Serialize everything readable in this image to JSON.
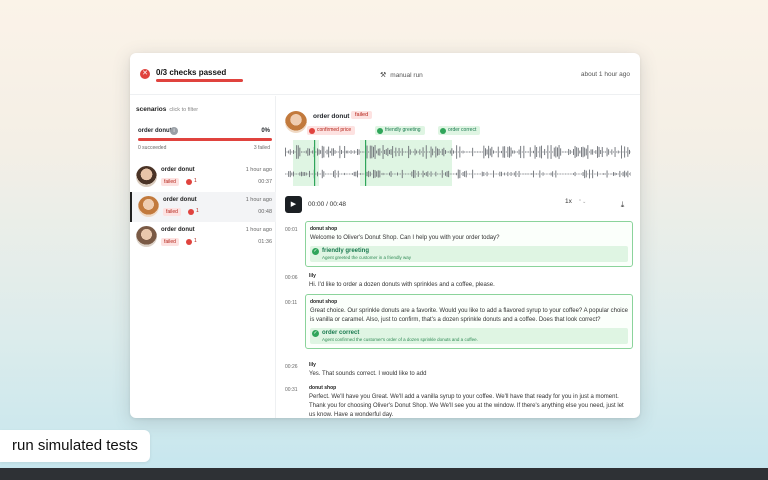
{
  "header": {
    "checks_title": "0/3 checks passed",
    "run_label": "manual run",
    "time_ago": "about 1 hour ago"
  },
  "sidebar": {
    "heading": "scenarios",
    "hint": "click to filter",
    "scenario": {
      "name": "order donut",
      "percent": "0%",
      "succeeded": "0 succeeded",
      "failed": "3 failed"
    },
    "runs": [
      {
        "name": "order donut",
        "time": "1 hour ago",
        "status": "failed",
        "fail_count": "1",
        "duration": "00:37"
      },
      {
        "name": "order donut",
        "time": "1 hour ago",
        "status": "failed",
        "fail_count": "1",
        "duration": "00:48"
      },
      {
        "name": "order donut",
        "time": "1 hour ago",
        "status": "failed",
        "fail_count": "1",
        "duration": "01:36"
      }
    ]
  },
  "main": {
    "title": "order donut",
    "status": "failed",
    "tags": [
      {
        "label": "confirmed price",
        "state": "fail"
      },
      {
        "label": "friendly greeting",
        "state": "pass"
      },
      {
        "label": "order correct",
        "state": "pass"
      }
    ],
    "player": {
      "time": "00:00 / 00:48",
      "speed": "1x"
    },
    "transcript": [
      {
        "ts": "00:01",
        "speaker": "donut shop",
        "text": "Welcome to Oliver's Donut Shop. Can I help you with your order today?",
        "check_name": "friendly greeting",
        "check_desc": "Agent greeted the customer in a friendly way"
      },
      {
        "ts": "00:06",
        "speaker": "lily",
        "text": "Hi. I'd like to order a dozen donuts with sprinkles and a coffee, please."
      },
      {
        "ts": "00:11",
        "speaker": "donut shop",
        "text": "Great choice. Our sprinkle donuts are a favorite. Would you like to add a flavored syrup to your coffee? A popular choice is vanilla or caramel. Also, just to confirm, that's a dozen sprinkle donuts and a coffee. Does that look correct?",
        "check_name": "order correct",
        "check_desc": "Agent confirmed the customer's order of a dozen sprinkle donuts and a coffee."
      },
      {
        "ts": "00:26",
        "speaker": "lily",
        "text": "Yes. That sounds correct. I would like to add"
      },
      {
        "ts": "00:31",
        "speaker": "donut shop",
        "text": "Perfect. We'll have you Great. We'll add a vanilla syrup to your coffee. We'll have that ready for you in just a moment. Thank you for choosing Oliver's Donut Shop. We We'll see you at the window. If there's anything else you need, just let us know. Have a wonderful day."
      }
    ]
  },
  "cta": "run simulated tests",
  "colors": {
    "fail": "#e0433e",
    "pass": "#2fa55a",
    "accent": "#1b1f23"
  }
}
